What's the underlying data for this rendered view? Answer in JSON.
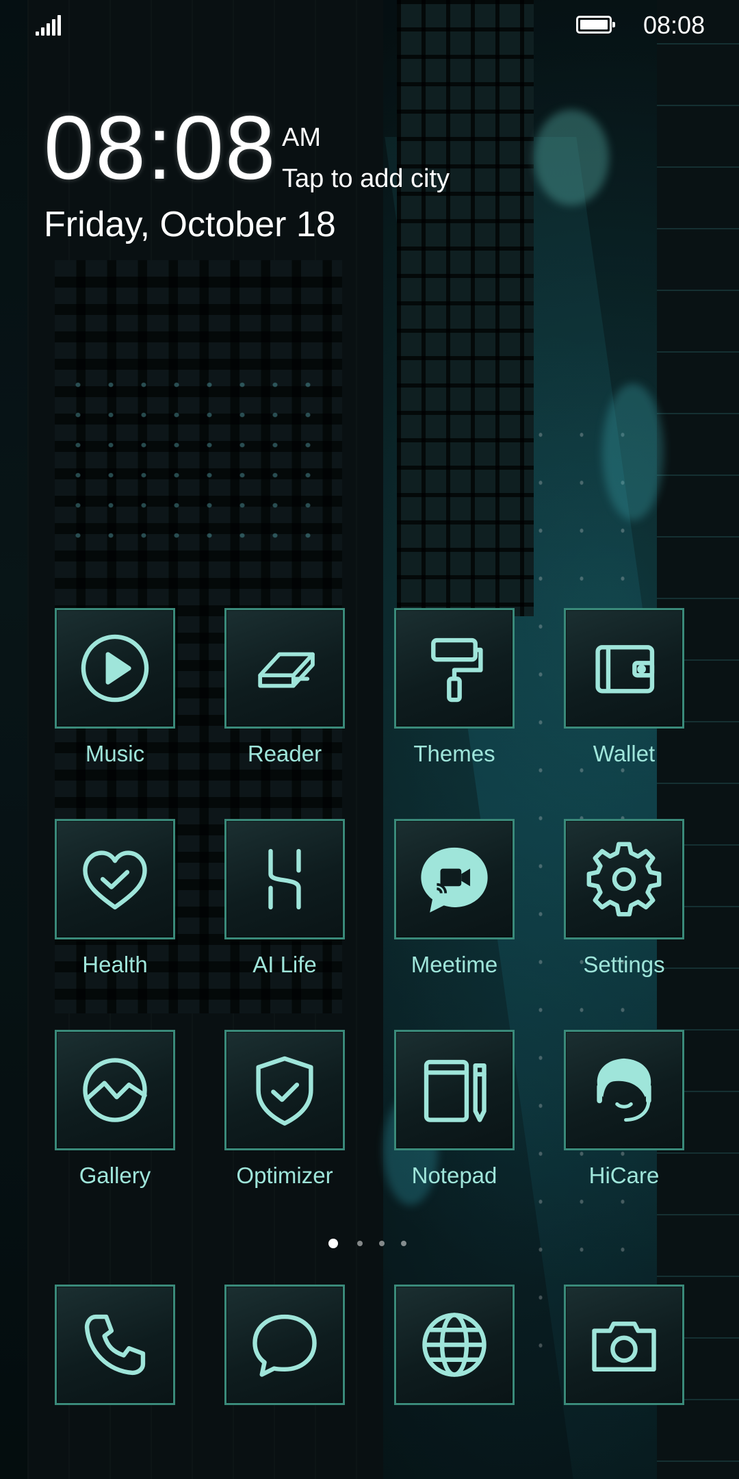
{
  "status_bar": {
    "time": "08:08",
    "signal_icon": "signal-bars-icon",
    "battery_icon": "battery-full-icon"
  },
  "clock_widget": {
    "time": "08:08",
    "ampm": "AM",
    "city_prompt": "Tap to add city",
    "date": "Friday, October 18"
  },
  "apps": [
    {
      "label": "Music",
      "icon": "play-circle-icon"
    },
    {
      "label": "Reader",
      "icon": "book-icon"
    },
    {
      "label": "Themes",
      "icon": "paint-roller-icon"
    },
    {
      "label": "Wallet",
      "icon": "wallet-icon"
    },
    {
      "label": "Health",
      "icon": "heart-check-icon"
    },
    {
      "label": "AI Life",
      "icon": "ai-life-icon"
    },
    {
      "label": "Meetime",
      "icon": "video-chat-icon"
    },
    {
      "label": "Settings",
      "icon": "gear-icon"
    },
    {
      "label": "Gallery",
      "icon": "gallery-icon"
    },
    {
      "label": "Optimizer",
      "icon": "shield-check-icon"
    },
    {
      "label": "Notepad",
      "icon": "notepad-icon"
    },
    {
      "label": "HiCare",
      "icon": "headset-icon"
    }
  ],
  "dock": [
    {
      "icon": "phone-icon"
    },
    {
      "icon": "message-bubble-icon"
    },
    {
      "icon": "globe-icon"
    },
    {
      "icon": "camera-icon"
    }
  ],
  "pager": {
    "pages": 4,
    "active_page": 1
  },
  "theme": {
    "accent": "#9fe5da",
    "tile_border": "#3a8a7a"
  }
}
